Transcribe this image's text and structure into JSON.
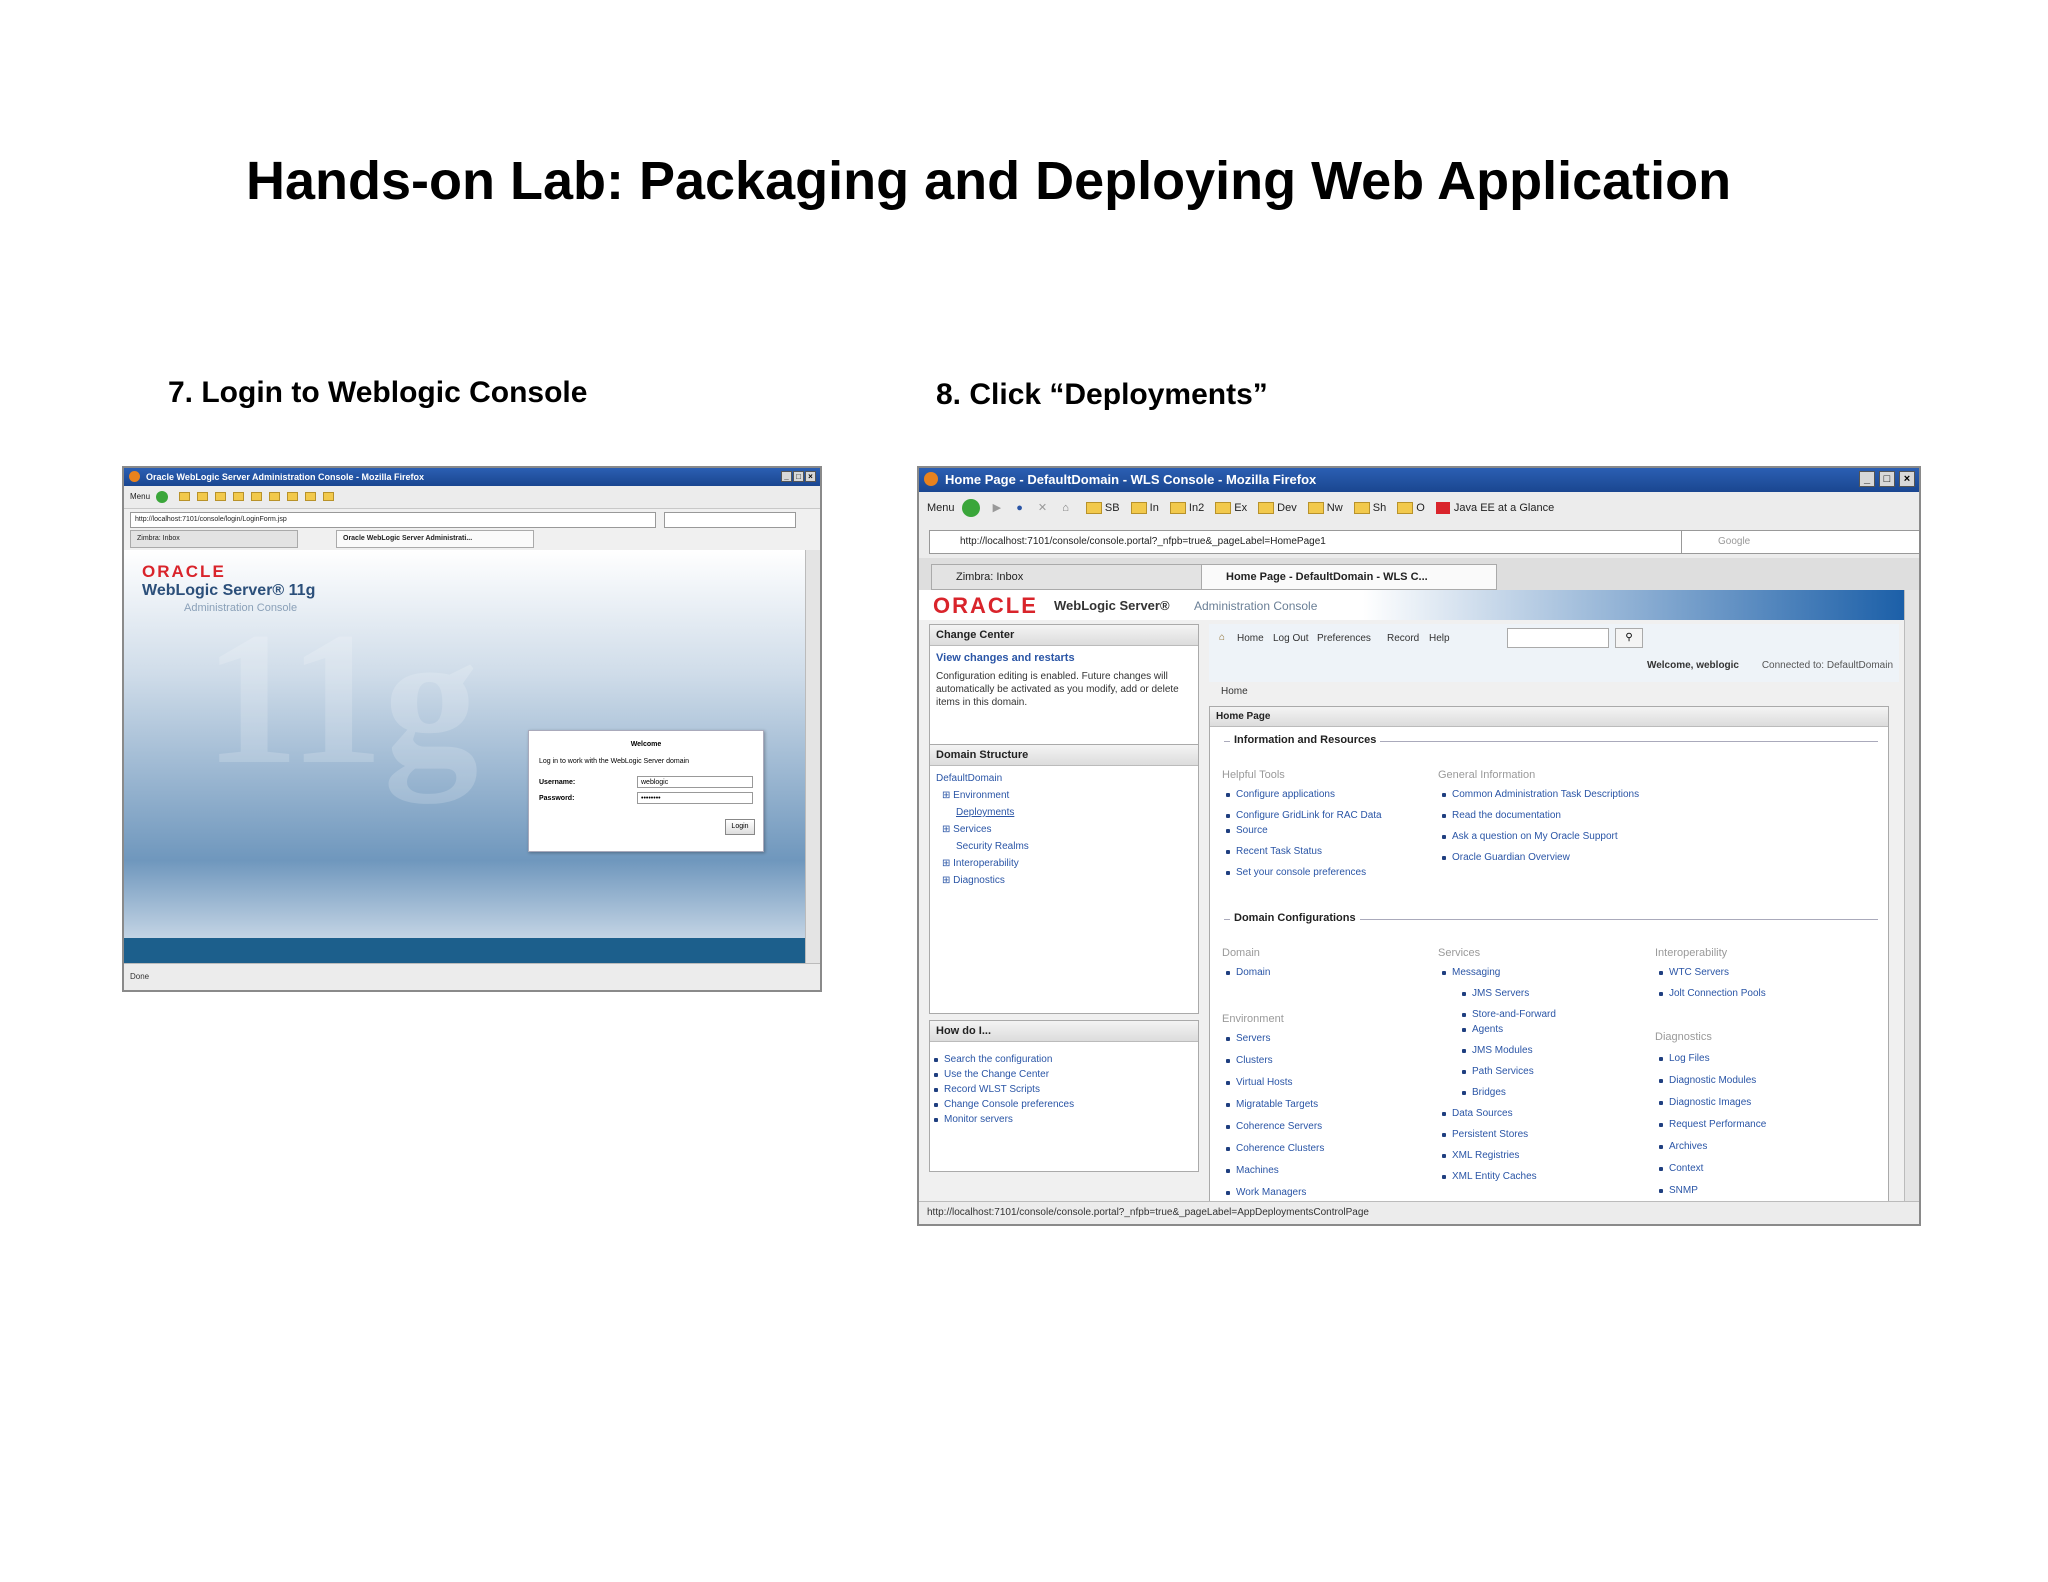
{
  "slide": {
    "title": "Hands-on Lab: Packaging and Deploying Web Application",
    "step7": "7. Login to Weblogic Console",
    "step8": "8. Click “Deployments”"
  },
  "shot1": {
    "window_title": "Oracle WebLogic Server Administration Console - Mozilla Firefox",
    "url": "http://localhost:7101/console/login/LoginForm.jsp",
    "tabs": [
      "Zimbra: Inbox",
      "Oracle WebLogic Server Administrati..."
    ],
    "oracle_logo": "ORACLE",
    "product": "WebLogic Server® 11g",
    "console_label": "Administration Console",
    "watermark": "11g",
    "login": {
      "heading": "Welcome",
      "instruction": "Log in to work with the WebLogic Server domain",
      "username_label": "Username:",
      "username_value": "weblogic",
      "password_label": "Password:",
      "password_value": "••••••••",
      "login_button": "Login"
    },
    "status": "Done"
  },
  "shot2": {
    "window_title": "Home Page - DefaultDomain - WLS Console - Mozilla Firefox",
    "menu_label": "Menu",
    "bookmarks": [
      "SB",
      "In",
      "In2",
      "Ex",
      "Dev",
      "Nw",
      "Sh",
      "O"
    ],
    "bookmark_special": "Java EE at a Glance",
    "url": "http://localhost:7101/console/console.portal?_nfpb=true&_pageLabel=HomePage1",
    "search_placeholder": "Google",
    "tabs": [
      "Zimbra: Inbox",
      "Home Page - DefaultDomain - WLS C..."
    ],
    "oracle_logo": "ORACLE",
    "product": "WebLogic Server®",
    "console_label": "Administration Console",
    "toolbar": [
      "Home",
      "Log Out",
      "Preferences",
      "Record",
      "Help"
    ],
    "welcome": "Welcome, weblogic",
    "connected": "Connected to: DefaultDomain",
    "breadcrumb": "Home",
    "change_center": {
      "title": "Change Center",
      "link": "View changes and restarts",
      "text": "Configuration editing is enabled. Future changes will automatically be activated as you modify, add or delete items in this domain."
    },
    "domain_structure": {
      "title": "Domain Structure",
      "items": [
        "DefaultDomain",
        "⊞ Environment",
        "Deployments",
        "⊞ Services",
        "Security Realms",
        "⊞ Interoperability",
        "⊞ Diagnostics"
      ]
    },
    "how_do_i": {
      "title": "How do I...",
      "items": [
        "Search the configuration",
        "Use the Change Center",
        "Record WLST Scripts",
        "Change Console preferences",
        "Monitor servers"
      ]
    },
    "home_page": {
      "title": "Home Page",
      "info_section": "Information and Resources",
      "helpful_tools_title": "Helpful Tools",
      "helpful_tools": [
        "Configure applications",
        "Configure GridLink for RAC Data",
        "Source",
        "Recent Task Status",
        "Set your console preferences"
      ],
      "general_info_title": "General Information",
      "general_info": [
        "Common Administration Task Descriptions",
        "Read the documentation",
        "Ask a question on My Oracle Support",
        "Oracle Guardian Overview"
      ],
      "domain_config_section": "Domain Configurations",
      "domain_title": "Domain",
      "domain_items": [
        "Domain"
      ],
      "environment_title": "Environment",
      "environment_items": [
        "Servers",
        "Clusters",
        "Virtual Hosts",
        "Migratable Targets",
        "Coherence Servers",
        "Coherence Clusters",
        "Machines",
        "Work Managers"
      ],
      "services_title": "Services",
      "services_items": [
        "Messaging",
        "JMS Servers",
        "Store-and-Forward",
        "Agents",
        "JMS Modules",
        "Path Services",
        "Bridges",
        "Data Sources",
        "Persistent Stores",
        "XML Registries",
        "XML Entity Caches"
      ],
      "interop_title": "Interoperability",
      "interop_items": [
        "WTC Servers",
        "Jolt Connection Pools"
      ],
      "diagnostics_title": "Diagnostics",
      "diagnostics_items": [
        "Log Files",
        "Diagnostic Modules",
        "Diagnostic Images",
        "Request Performance",
        "Archives",
        "Context",
        "SNMP"
      ]
    },
    "status_url": "http://localhost:7101/console/console.portal?_nfpb=true&_pageLabel=AppDeploymentsControlPage"
  },
  "colors": {
    "oracle_red": "#d9242b",
    "title_bar": "#1f4f9e",
    "link": "#2a55a6"
  }
}
